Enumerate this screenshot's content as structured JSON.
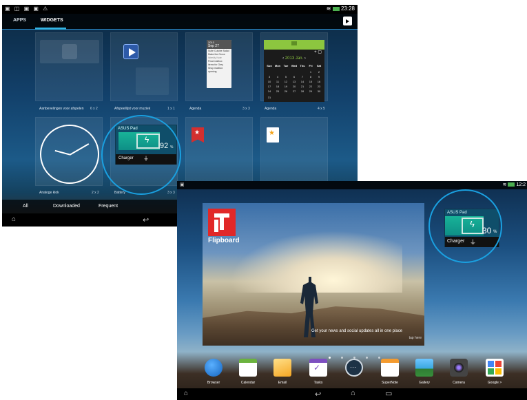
{
  "screen1": {
    "status_bar": {
      "time": "23:28"
    },
    "tabs": [
      {
        "label": "APPS"
      },
      {
        "label": "WIDGETS"
      }
    ],
    "widgets": [
      {
        "label": "Aanbevelingen voor afspelen",
        "size": "6 x 2"
      },
      {
        "label": "Afspeellijst voor muziek",
        "size": "1 x 1"
      },
      {
        "label": "Agenda",
        "size": "3 x 3"
      },
      {
        "label": "Agenda",
        "size": "4 x 5"
      },
      {
        "label": "Analoge klok",
        "size": "2 x 2"
      },
      {
        "label": "Battery",
        "size": "3 x 3"
      }
    ],
    "agenda_mini": {
      "year": "2013",
      "month_short": "Sep 27",
      "events": [
        "Suite Cuisine Salad",
        "Make the Grove",
        "Weekly Note",
        "Final mailbox",
        "items for Grey",
        "Shop mailbox opening"
      ]
    },
    "agenda_month": {
      "title": "2013 Jan.",
      "weekdays": [
        "Sun",
        "Mon",
        "Tue",
        "Wed",
        "Thu",
        "Fri",
        "Sat"
      ],
      "weeks": [
        [
          "",
          "",
          "",
          "",
          "",
          "1",
          "2"
        ],
        [
          "3",
          "4",
          "5",
          "6",
          "7",
          "8",
          "9"
        ],
        [
          "10",
          "11",
          "12",
          "13",
          "14",
          "15",
          "16"
        ],
        [
          "17",
          "18",
          "19",
          "20",
          "21",
          "22",
          "23"
        ],
        [
          "24",
          "25",
          "26",
          "27",
          "28",
          "29",
          "30"
        ],
        [
          "31",
          "",
          "",
          "",
          "",
          "",
          ""
        ]
      ]
    },
    "battery_widget": {
      "device": "ASUS Pad",
      "percent": "92",
      "percent_unit": "%",
      "charger_label": "Charger"
    },
    "bottom_filters": [
      {
        "label": "All"
      },
      {
        "label": "Downloaded"
      },
      {
        "label": "Frequent"
      }
    ]
  },
  "screen2": {
    "status_bar": {
      "time": "12:2"
    },
    "flipboard": {
      "name": "Flipboard",
      "tagline": "Get your news and social updates all in one place",
      "tap_hint": "tap here"
    },
    "battery_widget": {
      "device": "ASUS Pad",
      "percent": "30",
      "percent_unit": "%",
      "charger_label": "Charger"
    },
    "dock_apps": [
      {
        "label": "Browser",
        "color": "#1e88e5"
      },
      {
        "label": "Calendar",
        "color": "#6bb33e"
      },
      {
        "label": "Email",
        "color": "#f5b52b"
      },
      {
        "label": "Tasks",
        "color": "#7d4fc0"
      },
      {
        "label": "Apps",
        "color": "#2b4a66"
      },
      {
        "label": "SuperNote",
        "color": "#f49b2f"
      },
      {
        "label": "Gallery",
        "color": "#3aa8e0"
      },
      {
        "label": "Camera",
        "color": "#333333"
      },
      {
        "label": "Google >",
        "color": "#5b9bd5"
      }
    ]
  },
  "colors": {
    "accent": "#33b5e5",
    "highlight_circle": "#1aa0e0",
    "battery_green": "#19b39b"
  }
}
